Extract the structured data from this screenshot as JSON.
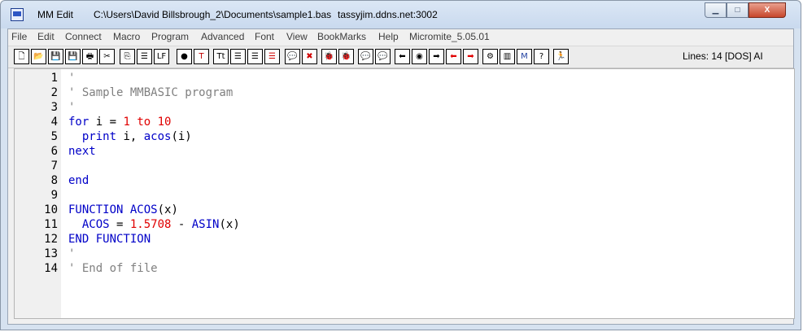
{
  "window": {
    "app_name": "MM Edit",
    "file_path": "C:\\Users\\David Billsbrough_2\\Documents\\sample1.bas",
    "host": "tassyjim.ddns.net:3002",
    "min_symbol": "▁",
    "max_symbol": "□",
    "close_symbol": "X"
  },
  "menu": [
    "File",
    "Edit",
    "Connect",
    "Macro",
    "Program",
    "Advanced",
    "Font",
    "View",
    "BookMarks",
    "Help",
    "Micromite_5.05.01"
  ],
  "toolbar": {
    "buttons": [
      {
        "name": "new-file-icon",
        "glyph": "🗋",
        "color": "#000000"
      },
      {
        "name": "open-folder-icon",
        "glyph": "📂",
        "color": "#d4a000"
      },
      {
        "name": "save-icon",
        "glyph": "💾",
        "color": "#1f3fa0"
      },
      {
        "name": "save-all-icon",
        "glyph": "💾",
        "color": "#1f3fa0"
      },
      {
        "name": "print-icon",
        "glyph": "🖶",
        "color": "#000000"
      },
      {
        "name": "cut-icon",
        "glyph": "✂",
        "color": "#000000"
      },
      {
        "name": "copy-icon",
        "glyph": "⎘",
        "color": "#000000"
      },
      {
        "name": "list-icon",
        "glyph": "☰",
        "color": "#000000"
      },
      {
        "name": "line-feed-icon",
        "glyph": "LF",
        "color": "#000000"
      },
      {
        "name": "bullet-icon",
        "glyph": "●",
        "color": "#000000"
      },
      {
        "name": "text-highlight-icon",
        "glyph": "T",
        "color": "#c00000"
      },
      {
        "name": "text-case-icon",
        "glyph": "Tt",
        "color": "#000000"
      },
      {
        "name": "align-left-icon",
        "glyph": "☰",
        "color": "#000000"
      },
      {
        "name": "align-right-icon",
        "glyph": "☰",
        "color": "#000000"
      },
      {
        "name": "align-red-icon",
        "glyph": "☰",
        "color": "#d00000"
      },
      {
        "name": "comment-bubble-icon",
        "glyph": "💬",
        "color": "#000000"
      },
      {
        "name": "delete-icon",
        "glyph": "✖",
        "color": "#d00000"
      },
      {
        "name": "bug-icon",
        "glyph": "🐞",
        "color": "#2e8b2e"
      },
      {
        "name": "bug-stop-icon",
        "glyph": "🐞",
        "color": "#a02020"
      },
      {
        "name": "add-breakpoint-icon",
        "glyph": "💬",
        "color": "#2e8b2e"
      },
      {
        "name": "remove-breakpoint-icon",
        "glyph": "💬",
        "color": "#c00000"
      },
      {
        "name": "arrow-left-icon",
        "glyph": "⬅",
        "color": "#000000"
      },
      {
        "name": "record-icon",
        "glyph": "◉",
        "color": "#000000"
      },
      {
        "name": "arrow-right-icon",
        "glyph": "➡",
        "color": "#000000"
      },
      {
        "name": "red-arrow-left-icon",
        "glyph": "⬅",
        "color": "#e00000"
      },
      {
        "name": "red-arrow-right-icon",
        "glyph": "➡",
        "color": "#e00000"
      },
      {
        "name": "gear-icon",
        "glyph": "⚙",
        "color": "#000000"
      },
      {
        "name": "columns-icon",
        "glyph": "▥",
        "color": "#000000"
      },
      {
        "name": "mm-icon",
        "glyph": "M",
        "color": "#1f3fa0"
      },
      {
        "name": "help-icon",
        "glyph": "?",
        "color": "#000000"
      },
      {
        "name": "run-man-icon",
        "glyph": "🏃",
        "color": "#1f3fa0"
      }
    ],
    "status": "Lines: 14 [DOS]  AI"
  },
  "editor": {
    "lines": [
      {
        "no": "1",
        "tokens": [
          {
            "t": "'",
            "c": "cmt"
          }
        ]
      },
      {
        "no": "2",
        "tokens": [
          {
            "t": "' Sample MMBASIC program",
            "c": "cmt"
          }
        ]
      },
      {
        "no": "3",
        "tokens": [
          {
            "t": "'",
            "c": "cmt"
          }
        ]
      },
      {
        "no": "4",
        "tokens": [
          {
            "t": "for",
            "c": "kw"
          },
          {
            "t": " i = ",
            "c": "txt"
          },
          {
            "t": "1",
            "c": "num"
          },
          {
            "t": " ",
            "c": "txt"
          },
          {
            "t": "to",
            "c": "num"
          },
          {
            "t": " ",
            "c": "txt"
          },
          {
            "t": "10",
            "c": "num"
          }
        ]
      },
      {
        "no": "5",
        "tokens": [
          {
            "t": "  ",
            "c": "txt"
          },
          {
            "t": "print",
            "c": "kw"
          },
          {
            "t": " i, ",
            "c": "txt"
          },
          {
            "t": "acos",
            "c": "kw"
          },
          {
            "t": "(i)",
            "c": "txt"
          }
        ]
      },
      {
        "no": "6",
        "tokens": [
          {
            "t": "next",
            "c": "kw"
          }
        ]
      },
      {
        "no": "7",
        "tokens": []
      },
      {
        "no": "8",
        "tokens": [
          {
            "t": "end",
            "c": "kw"
          }
        ]
      },
      {
        "no": "9",
        "tokens": []
      },
      {
        "no": "10",
        "tokens": [
          {
            "t": "FUNCTION",
            "c": "kw"
          },
          {
            "t": " ",
            "c": "txt"
          },
          {
            "t": "ACOS",
            "c": "kw"
          },
          {
            "t": "(x)",
            "c": "txt"
          }
        ]
      },
      {
        "no": "11",
        "tokens": [
          {
            "t": "  ",
            "c": "txt"
          },
          {
            "t": "ACOS",
            "c": "kw"
          },
          {
            "t": " = ",
            "c": "txt"
          },
          {
            "t": "1.5708",
            "c": "num"
          },
          {
            "t": " - ",
            "c": "txt"
          },
          {
            "t": "ASIN",
            "c": "kw"
          },
          {
            "t": "(x)",
            "c": "txt"
          }
        ]
      },
      {
        "no": "12",
        "tokens": [
          {
            "t": "END FUNCTION",
            "c": "kw"
          }
        ]
      },
      {
        "no": "13",
        "tokens": [
          {
            "t": "'",
            "c": "cmt"
          }
        ]
      },
      {
        "no": "14",
        "tokens": [
          {
            "t": "' End of file",
            "c": "cmt"
          }
        ]
      }
    ]
  }
}
